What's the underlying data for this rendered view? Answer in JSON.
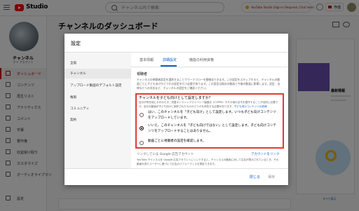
{
  "topbar": {
    "logo_text": "Studio",
    "search_placeholder": "チャンネル内で検索",
    "banner_text": "YouTube Studio (Sign-in Required, Click here)",
    "create_label": "作成"
  },
  "sidebar": {
    "channel_name": "チャンネル",
    "channel_sub": "マイ アカウント",
    "items": [
      {
        "label": "ダッシュボード",
        "active": true
      },
      {
        "label": "コンテンツ"
      },
      {
        "label": "再生リスト"
      },
      {
        "label": "アナリティクス"
      },
      {
        "label": "コメント"
      },
      {
        "label": "字幕"
      },
      {
        "label": "著作権"
      },
      {
        "label": "収益受け取り"
      },
      {
        "label": "カスタマイズ"
      },
      {
        "label": "オーディオライブラリ"
      }
    ],
    "settings_label": "設定"
  },
  "page": {
    "title": "チャンネルのダッシュボード",
    "bg_card_text": "最新情報",
    "bg_link": "すべて表示"
  },
  "dialog": {
    "title": "設定",
    "categories": [
      {
        "label": "全般"
      },
      {
        "label": "チャンネル",
        "active": true
      },
      {
        "label": "アップロード動画のデフォルト設定"
      },
      {
        "label": "権限"
      },
      {
        "label": "コミュニティ"
      },
      {
        "label": "契約"
      }
    ],
    "tabs": [
      {
        "label": "基本情報"
      },
      {
        "label": "詳細設定",
        "active": true
      },
      {
        "label": "機能の利用資格"
      }
    ],
    "section_heading": "視聴者",
    "section_desc": "チャンネルの視聴者設定を選択することでワークフローを簡略化できます。この設定をスキップすると、チャンネルの動画ごとに子ども向けかどうかの設定を行う必要があります。この設定は既存の動画と今後の動画に影響します。設定、法律などへの対応など、チャンネルの設定をご確認ください。",
    "question": {
      "title": "チャンネルを子ども向けとして設定しますか？",
      "desc": "自分が所在地にかかわらず、児童オンラインプライバシー保護法（COPPA）やその他の法令を遵守することが法的に必要です。自分の動画が子ども向けに制作されたものかどうかを申告する必要があります。",
      "link": "子ども向けコンテンツの詳細",
      "options": [
        {
          "text": "はい、このチャンネルを「子ども向け」として設定します。いつも子ども向けコンテンツをアップロードしています。",
          "selected": false
        },
        {
          "text": "いいえ、このチャンネルを「子ども向けではない」として設定します。子ども向けコンテンツをアップロードすることはありません。",
          "selected": true
        },
        {
          "text": "動画ごとに視聴者の設定を確認します。",
          "selected": false
        }
      ]
    },
    "linked_account_label": "リンクしている Google 広告アカウント",
    "linked_account_link": "アカウントをリンク",
    "linked_desc": "YouTube チャンネルを Google 広告アカウントにリンクすると、チャンネルの動画に対して広告が表示されているとき、その動画を見たユーザーに基づいて広告のパフォーマンスを測定できます。",
    "close_label": "閉じる",
    "save_label": "保存"
  }
}
